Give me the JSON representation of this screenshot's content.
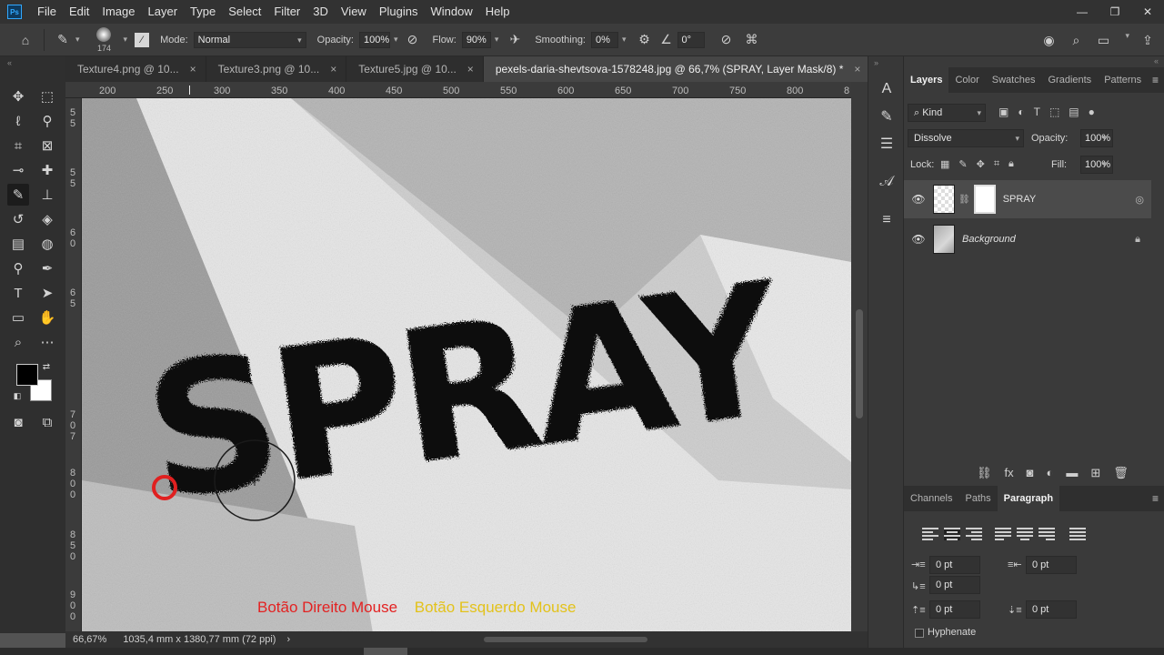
{
  "app": {
    "logo": "Ps"
  },
  "menu": [
    "File",
    "Edit",
    "Image",
    "Layer",
    "Type",
    "Select",
    "Filter",
    "3D",
    "View",
    "Plugins",
    "Window",
    "Help"
  ],
  "window_controls": [
    "—",
    "❐",
    "✕"
  ],
  "options": {
    "brush_size": "174",
    "mode_label": "Mode:",
    "mode_value": "Normal",
    "opacity_label": "Opacity:",
    "opacity_value": "100%",
    "flow_label": "Flow:",
    "flow_value": "90%",
    "smoothing_label": "Smoothing:",
    "smoothing_value": "0%",
    "angle_value": "0°"
  },
  "tabs": [
    {
      "label": "Texture4.png @ 10...",
      "close": "×"
    },
    {
      "label": "Texture3.png @ 10...",
      "close": "×"
    },
    {
      "label": "Texture5.jpg @ 10...",
      "close": "×"
    },
    {
      "label": "pexels-daria-shevtsova-1578248.jpg @ 66,7% (SPRAY, Layer Mask/8) *",
      "close": "×"
    }
  ],
  "ruler_h": [
    "200",
    "250",
    "300",
    "350",
    "400",
    "450",
    "500",
    "550",
    "600",
    "650",
    "700",
    "750",
    "800",
    "8"
  ],
  "ruler_v": [
    "5",
    "5",
    "5",
    "5",
    "6",
    "0",
    "6",
    "5",
    "7",
    "0",
    "7",
    "5",
    "8",
    "0",
    "0",
    "8",
    "5",
    "0",
    "9",
    "0",
    "0"
  ],
  "canvas": {
    "spray_text": "SPRAY",
    "overlay_right": "Botão Direito Mouse",
    "overlay_left": "Botão Esquerdo Mouse"
  },
  "status": {
    "zoom": "66,67%",
    "doc_size": "1035,4 mm x 1380,77 mm (72 ppi)",
    "arrow": "›"
  },
  "panels": {
    "top_tabs": [
      "Layers",
      "Color",
      "Swatches",
      "Gradients",
      "Patterns"
    ],
    "filter_kind": "Kind",
    "blend_mode": "Dissolve",
    "opacity_label": "Opacity:",
    "opacity_value": "100%",
    "lock_label": "Lock:",
    "fill_label": "Fill:",
    "fill_value": "100%",
    "layers": [
      {
        "name": "SPRAY"
      },
      {
        "name": "Background"
      }
    ],
    "bottom_tabs": [
      "Channels",
      "Paths",
      "Paragraph"
    ],
    "paragraph": {
      "indent_left": "0 pt",
      "indent_right": "0 pt",
      "indent_first": "0 pt",
      "space_before": "0 pt",
      "space_after": "0 pt",
      "hyphenate": "Hyphenate"
    }
  },
  "colors": {
    "accent": "#31a8ff",
    "foreground": "#000000",
    "background": "#ffffff",
    "overlay_red": "#e32222",
    "overlay_yellow": "#e3c21a"
  }
}
